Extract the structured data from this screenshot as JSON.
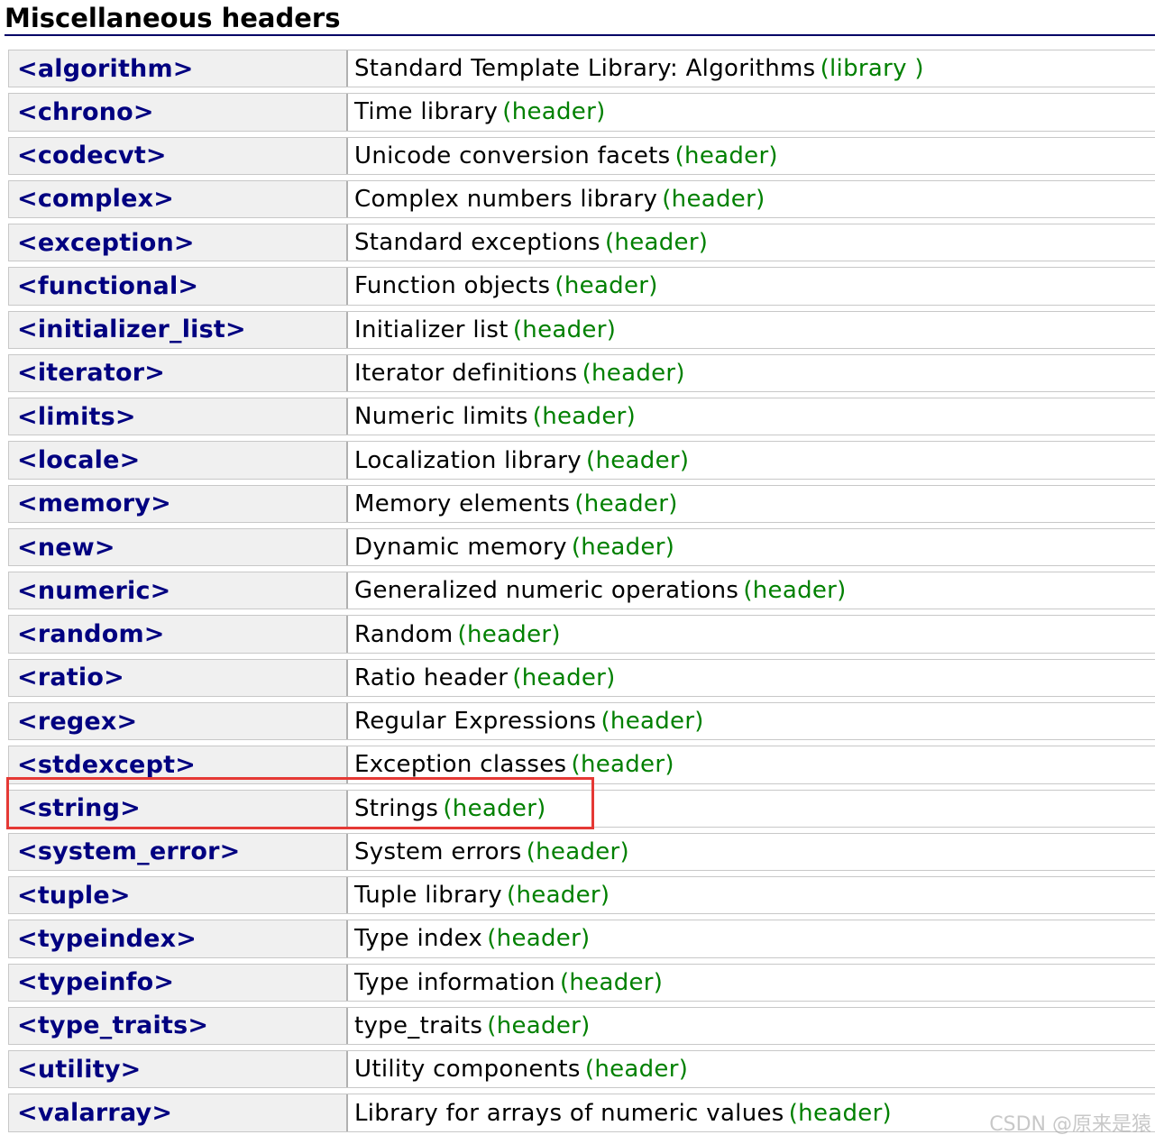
{
  "section": {
    "title": "Miscellaneous headers"
  },
  "rows": [
    {
      "header": "<algorithm>",
      "description": "Standard Template Library: Algorithms",
      "kind": "(library )"
    },
    {
      "header": "<chrono>",
      "description": "Time library",
      "kind": "(header)"
    },
    {
      "header": "<codecvt>",
      "description": "Unicode conversion facets",
      "kind": "(header)"
    },
    {
      "header": "<complex>",
      "description": "Complex numbers library",
      "kind": "(header)"
    },
    {
      "header": "<exception>",
      "description": "Standard exceptions",
      "kind": "(header)"
    },
    {
      "header": "<functional>",
      "description": "Function objects",
      "kind": "(header)"
    },
    {
      "header": "<initializer_list>",
      "description": "Initializer list",
      "kind": "(header)"
    },
    {
      "header": "<iterator>",
      "description": "Iterator definitions",
      "kind": "(header)"
    },
    {
      "header": "<limits>",
      "description": "Numeric limits",
      "kind": "(header)"
    },
    {
      "header": "<locale>",
      "description": "Localization library",
      "kind": "(header)"
    },
    {
      "header": "<memory>",
      "description": "Memory elements",
      "kind": "(header)"
    },
    {
      "header": "<new>",
      "description": "Dynamic memory",
      "kind": "(header)"
    },
    {
      "header": "<numeric>",
      "description": "Generalized numeric operations",
      "kind": "(header)"
    },
    {
      "header": "<random>",
      "description": "Random",
      "kind": "(header)"
    },
    {
      "header": "<ratio>",
      "description": "Ratio header",
      "kind": "(header)"
    },
    {
      "header": "<regex>",
      "description": "Regular Expressions",
      "kind": "(header)"
    },
    {
      "header": "<stdexcept>",
      "description": "Exception classes",
      "kind": "(header)"
    },
    {
      "header": "<string>",
      "description": "Strings",
      "kind": "(header)"
    },
    {
      "header": "<system_error>",
      "description": "System errors",
      "kind": "(header)"
    },
    {
      "header": "<tuple>",
      "description": "Tuple library",
      "kind": "(header)"
    },
    {
      "header": "<typeindex>",
      "description": "Type index",
      "kind": "(header)"
    },
    {
      "header": "<typeinfo>",
      "description": "Type information",
      "kind": "(header)"
    },
    {
      "header": "<type_traits>",
      "description": "type_traits",
      "kind": "(header)"
    },
    {
      "header": "<utility>",
      "description": "Utility components",
      "kind": "(header)"
    },
    {
      "header": "<valarray>",
      "description": "Library for arrays of numeric values",
      "kind": "(header)"
    }
  ],
  "highlight": {
    "row_header": "<string>",
    "color": "#e53935"
  },
  "watermark": {
    "text": "CSDN @原来是猿"
  },
  "colors": {
    "header_link": "#000080",
    "kind_label": "#008000",
    "header_cell_bg": "#f0f0f0",
    "title_rule": "#000066"
  }
}
